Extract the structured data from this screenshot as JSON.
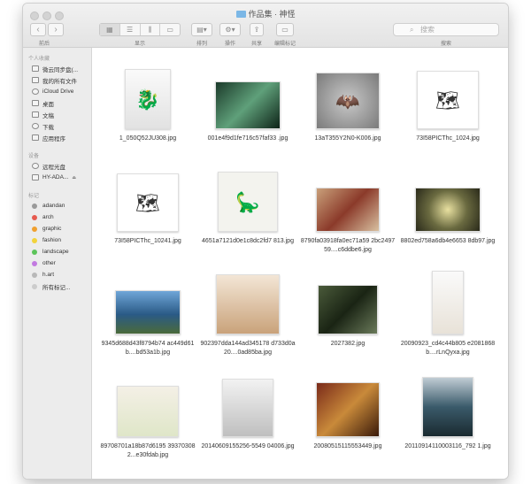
{
  "window": {
    "title": "作品集 · 神怪",
    "nav_label": "前后",
    "toolbar_labels": {
      "view": "显示",
      "arrange": "排列",
      "action": "操作",
      "share": "共享",
      "tag": "编辑标记"
    },
    "search_placeholder": "搜索",
    "search_label": "搜索"
  },
  "sidebar": {
    "sections": [
      {
        "heading": "个人收藏",
        "items": [
          {
            "label": "微云同步盘(...",
            "icon": "cloud-drive-icon"
          },
          {
            "label": "我的所有文件",
            "icon": "all-files-icon"
          },
          {
            "label": "iCloud Drive",
            "icon": "icloud-icon"
          },
          {
            "label": "桌面",
            "icon": "desktop-icon"
          },
          {
            "label": "文稿",
            "icon": "documents-icon"
          },
          {
            "label": "下载",
            "icon": "downloads-icon"
          },
          {
            "label": "应用程序",
            "icon": "applications-icon"
          }
        ]
      },
      {
        "heading": "设备",
        "items": [
          {
            "label": "远程光盘",
            "icon": "remote-disc-icon"
          },
          {
            "label": "HY-ADA...",
            "icon": "hard-drive-icon",
            "eject": "⏏"
          }
        ]
      },
      {
        "heading": "标记",
        "items": [
          {
            "label": "adandan",
            "color": "#9a9a9a"
          },
          {
            "label": "arch",
            "color": "#e65a4f"
          },
          {
            "label": "graphic",
            "color": "#f0a030"
          },
          {
            "label": "fashion",
            "color": "#f2d33c"
          },
          {
            "label": "landscape",
            "color": "#5cc45a"
          },
          {
            "label": "other",
            "color": "#c27ae0"
          },
          {
            "label": "h.art",
            "color": "#b8b8b8"
          },
          {
            "label": "所有标记...",
            "color": "#cccccc"
          }
        ]
      }
    ]
  },
  "files": [
    {
      "name": "1_050Q52JU308.jpg",
      "thumb": "dragon-sketch"
    },
    {
      "name": "001e4f9d1fe716c57faf33 .jpg",
      "thumb": "creature-green"
    },
    {
      "name": "13aT355Y2N0-K006.jpg",
      "thumb": "winged-demon"
    },
    {
      "name": "73I58PICThc_1024.jpg",
      "thumb": "world-map"
    },
    {
      "name": "73I58PICThc_10241.jpg",
      "thumb": "world-map"
    },
    {
      "name": "4651a7121d0e1c8dc2fd7 813.jpg",
      "thumb": "sea-monster"
    },
    {
      "name": "8790fa03918fa0ec71a59 2bc249759....c6ddbe6.jpg",
      "thumb": "painting-red"
    },
    {
      "name": "8802ed758a6db4e6653 8db97.jpg",
      "thumb": "dragon-yellow"
    },
    {
      "name": "9345d688d43f8794b74 ac449d61b....bd53a1b.jpg",
      "thumb": "landscape-lake"
    },
    {
      "name": "902397dda144ad345178 d733d0a20....0ad85ba.jpg",
      "thumb": "figures-beast"
    },
    {
      "name": "2027382.jpg",
      "thumb": "forest-figure"
    },
    {
      "name": "20090923_cd4c44b805 e2081868b....rLnQyxa.jpg",
      "thumb": "standing-figure"
    },
    {
      "name": "89708701a18b87d6195 393703082...e30fdab.jpg",
      "thumb": "ship-creature"
    },
    {
      "name": "20140609155256-5549 04006.jpg",
      "thumb": "bat-creature"
    },
    {
      "name": "20080515115553449.jpg",
      "thumb": "painting-crowd"
    },
    {
      "name": "20110914110003116_792 1.jpg",
      "thumb": "serpent-wave"
    }
  ]
}
